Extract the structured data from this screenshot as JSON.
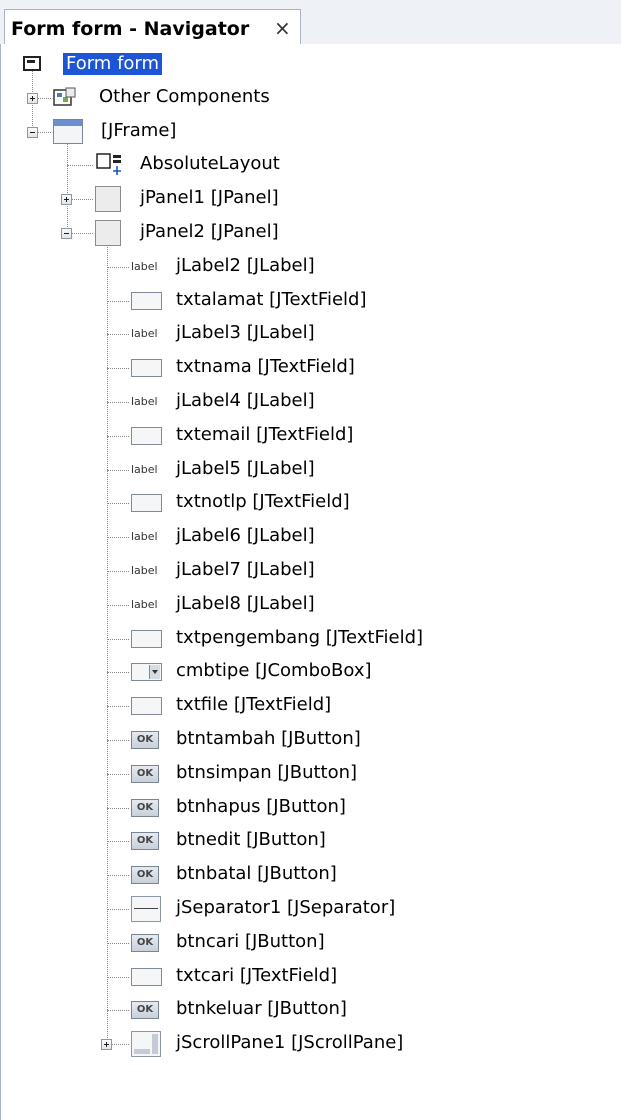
{
  "tab": {
    "title": "Form form - Navigator",
    "close": "×"
  },
  "tree": [
    {
      "key": "root",
      "label": "Form form",
      "icon": "form-icon",
      "toggle": "none",
      "selected": true
    },
    {
      "key": "other-components",
      "label": "Other Components",
      "icon": "other-components-icon",
      "toggle": "plus"
    },
    {
      "key": "jframe",
      "label": "[JFrame]",
      "icon": "jframe-icon",
      "toggle": "minus"
    },
    {
      "key": "absolute-layout",
      "label": "AbsoluteLayout",
      "icon": "absolute-layout-icon",
      "toggle": "none"
    },
    {
      "key": "jpanel1",
      "label": "jPanel1 [JPanel]",
      "icon": "jpanel-icon",
      "toggle": "plus"
    },
    {
      "key": "jpanel2",
      "label": "jPanel2 [JPanel]",
      "icon": "jpanel-icon",
      "toggle": "minus"
    },
    {
      "key": "jlabel2",
      "label": "jLabel2 [JLabel]",
      "icon": "label-icon",
      "toggle": "none"
    },
    {
      "key": "txtalamat",
      "label": "txtalamat [JTextField]",
      "icon": "textfield-icon",
      "toggle": "none"
    },
    {
      "key": "jlabel3",
      "label": "jLabel3 [JLabel]",
      "icon": "label-icon",
      "toggle": "none"
    },
    {
      "key": "txtnama",
      "label": "txtnama [JTextField]",
      "icon": "textfield-icon",
      "toggle": "none"
    },
    {
      "key": "jlabel4",
      "label": "jLabel4 [JLabel]",
      "icon": "label-icon",
      "toggle": "none"
    },
    {
      "key": "txtemail",
      "label": "txtemail [JTextField]",
      "icon": "textfield-icon",
      "toggle": "none"
    },
    {
      "key": "jlabel5",
      "label": "jLabel5 [JLabel]",
      "icon": "label-icon",
      "toggle": "none"
    },
    {
      "key": "txtnotlp",
      "label": "txtnotlp [JTextField]",
      "icon": "textfield-icon",
      "toggle": "none"
    },
    {
      "key": "jlabel6",
      "label": "jLabel6 [JLabel]",
      "icon": "label-icon",
      "toggle": "none"
    },
    {
      "key": "jlabel7",
      "label": "jLabel7 [JLabel]",
      "icon": "label-icon",
      "toggle": "none"
    },
    {
      "key": "jlabel8",
      "label": "jLabel8 [JLabel]",
      "icon": "label-icon",
      "toggle": "none"
    },
    {
      "key": "txtpengembang",
      "label": "txtpengembang [JTextField]",
      "icon": "textfield-icon",
      "toggle": "none"
    },
    {
      "key": "cmbtipe",
      "label": "cmbtipe [JComboBox]",
      "icon": "combobox-icon",
      "toggle": "none"
    },
    {
      "key": "txtfile",
      "label": "txtfile [JTextField]",
      "icon": "textfield-icon",
      "toggle": "none"
    },
    {
      "key": "btntambah",
      "label": "btntambah [JButton]",
      "icon": "button-icon",
      "toggle": "none"
    },
    {
      "key": "btnsimpan",
      "label": "btnsimpan [JButton]",
      "icon": "button-icon",
      "toggle": "none"
    },
    {
      "key": "btnhapus",
      "label": "btnhapus [JButton]",
      "icon": "button-icon",
      "toggle": "none"
    },
    {
      "key": "btnedit",
      "label": "btnedit [JButton]",
      "icon": "button-icon",
      "toggle": "none"
    },
    {
      "key": "btnbatal",
      "label": "btnbatal [JButton]",
      "icon": "button-icon",
      "toggle": "none"
    },
    {
      "key": "jseparator1",
      "label": "jSeparator1 [JSeparator]",
      "icon": "separator-icon",
      "toggle": "none"
    },
    {
      "key": "btncari",
      "label": "btncari [JButton]",
      "icon": "button-icon",
      "toggle": "none"
    },
    {
      "key": "txtcari",
      "label": "txtcari [JTextField]",
      "icon": "textfield-icon",
      "toggle": "none"
    },
    {
      "key": "btnkeluar",
      "label": "btnkeluar [JButton]",
      "icon": "button-icon",
      "toggle": "none"
    },
    {
      "key": "jscrollpane1",
      "label": "jScrollPane1 [JScrollPane]",
      "icon": "scrollpane-icon",
      "toggle": "plus"
    }
  ],
  "button_icon_text": "OK",
  "label_icon_text": "label",
  "colors": {
    "selection": "#1c55d6",
    "tab_bg": "#eef1f6",
    "border": "#a9b3c2"
  }
}
